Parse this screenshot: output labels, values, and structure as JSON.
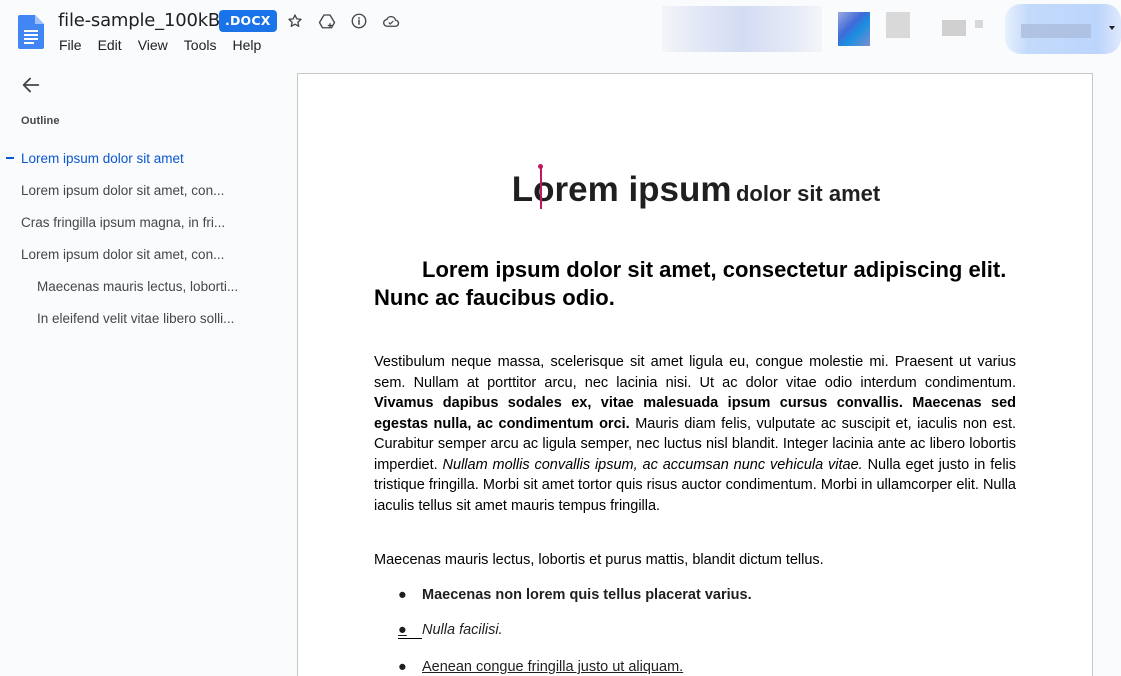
{
  "header": {
    "title": "file-sample_100kB",
    "badge": ".DOCX",
    "menu": [
      "File",
      "Edit",
      "View",
      "Tools",
      "Help"
    ]
  },
  "sidebar": {
    "outline_label": "Outline",
    "items": [
      "Lorem ipsum dolor sit amet",
      "Lorem ipsum dolor sit amet, con...",
      "Cras fringilla ipsum magna, in fri...",
      "Lorem ipsum dolor sit amet, con...",
      "Maecenas mauris lectus, loborti...",
      "In eleifend velit vitae libero solli..."
    ]
  },
  "document": {
    "title_big": "Lorem ipsum",
    "title_small": "dolor sit amet",
    "heading2": "Lorem ipsum dolor sit amet, consectetur adipiscing elit. Nunc ac faucibus odio.",
    "para1": {
      "part1": "Vestibulum neque massa, scelerisque sit amet ligula eu, congue molestie mi. Praesent ut varius sem. Nullam at porttitor arcu, nec lacinia nisi. Ut ac dolor vitae odio interdum condimentum. ",
      "bold": "Vivamus dapibus sodales ex, vitae malesuada ipsum cursus convallis. Maecenas sed egestas nulla, ac condimentum orci.",
      "part2": " Mauris diam felis, vulputate ac suscipit et, iaculis non est. Curabitur semper arcu ac ligula semper, nec luctus nisl blandit. Integer lacinia ante ac libero lobortis imperdiet. ",
      "italic": "Nullam mollis convallis ipsum, ac accumsan nunc vehicula vitae.",
      "part3": " Nulla eget justo in felis tristique fringilla. Morbi sit amet tortor quis risus auctor condimentum. Morbi in ullamcorper elit. Nulla iaculis tellus sit amet mauris tempus fringilla."
    },
    "para2": "Maecenas mauris lectus, lobortis et purus mattis, blandit dictum tellus.",
    "bullets": [
      "Maecenas non lorem quis tellus placerat varius.",
      "Nulla facilisi.",
      "Aenean congue fringilla justo ut aliquam."
    ],
    "bullet_symbol": "●"
  }
}
